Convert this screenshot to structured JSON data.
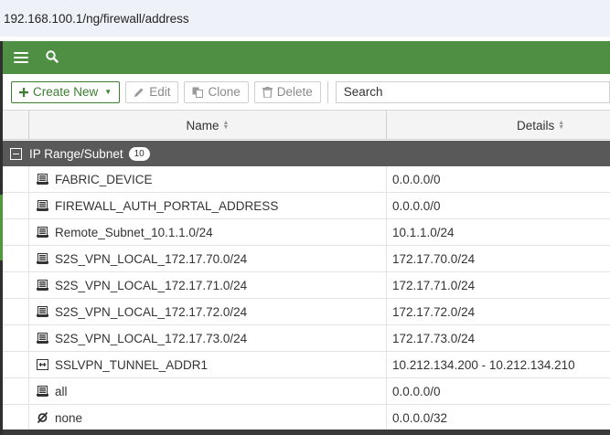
{
  "browser": {
    "url": "192.168.100.1/ng/firewall/address"
  },
  "topbar": {
    "menu_icon": "hamburger-icon",
    "search_icon": "search-icon",
    "color": "#4f8f44"
  },
  "toolbar": {
    "create_new": "Create New",
    "edit": "Edit",
    "clone": "Clone",
    "delete": "Delete",
    "search_placeholder": "Search"
  },
  "table": {
    "columns": [
      "Name",
      "Details"
    ],
    "group": {
      "label": "IP Range/Subnet",
      "count": "10"
    },
    "rows": [
      {
        "icon": "subnet-icon",
        "name": "FABRIC_DEVICE",
        "details": "0.0.0.0/0"
      },
      {
        "icon": "subnet-icon",
        "name": "FIREWALL_AUTH_PORTAL_ADDRESS",
        "details": "0.0.0.0/0"
      },
      {
        "icon": "subnet-icon",
        "name": "Remote_Subnet_10.1.1.0/24",
        "details": "10.1.1.0/24"
      },
      {
        "icon": "subnet-icon",
        "name": "S2S_VPN_LOCAL_172.17.70.0/24",
        "details": "172.17.70.0/24"
      },
      {
        "icon": "subnet-icon",
        "name": "S2S_VPN_LOCAL_172.17.71.0/24",
        "details": "172.17.71.0/24"
      },
      {
        "icon": "subnet-icon",
        "name": "S2S_VPN_LOCAL_172.17.72.0/24",
        "details": "172.17.72.0/24"
      },
      {
        "icon": "subnet-icon",
        "name": "S2S_VPN_LOCAL_172.17.73.0/24",
        "details": "172.17.73.0/24"
      },
      {
        "icon": "ip-range-icon",
        "name": "SSLVPN_TUNNEL_ADDR1",
        "details": "10.212.134.200 - 10.212.134.210"
      },
      {
        "icon": "subnet-icon",
        "name": "all",
        "details": "0.0.0.0/0"
      },
      {
        "icon": "none-icon",
        "name": "none",
        "details": "0.0.0.0/32"
      }
    ]
  }
}
